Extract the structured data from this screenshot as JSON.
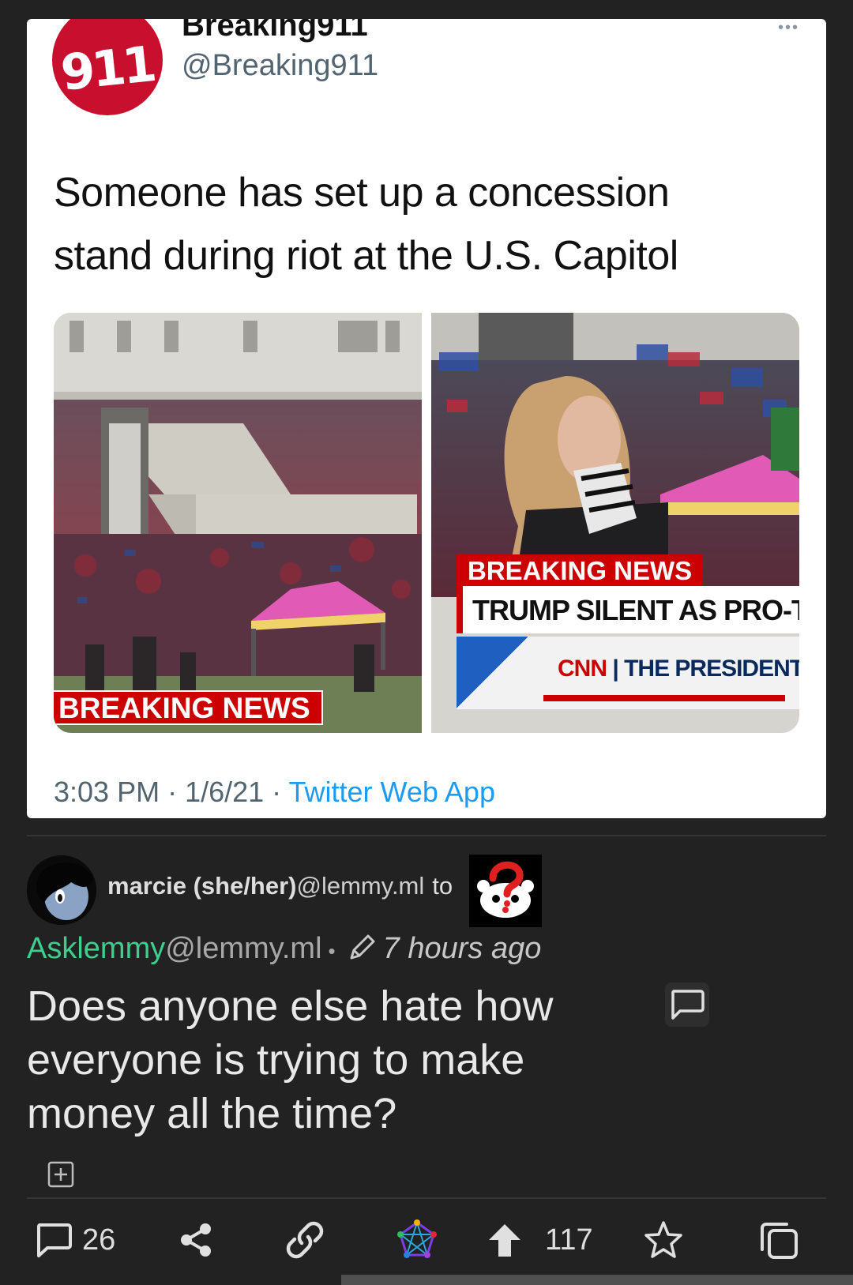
{
  "tweet": {
    "avatar_text": "911",
    "display_name": "Breaking911",
    "handle": "@Breaking911",
    "more_label": "•••",
    "text": "Someone has set up a concession stand during riot at the U.S. Capitol",
    "left_banner": "BREAKING NEWS",
    "right_banner": "BREAKING NEWS",
    "right_headline": "TRUMP SILENT AS PRO-T",
    "right_ticker_brand": "CNN",
    "right_ticker_text": "| THE PRESIDENTIAL ELE",
    "time": "3:03 PM",
    "date": "1/6/21",
    "separator": " · ",
    "app": "Twitter Web App"
  },
  "post": {
    "author_name": "marcie (she/her)",
    "author_instance": "@lemmy.ml",
    "to_label": "to",
    "community_name": "Asklemmy",
    "community_instance": "@lemmy.ml",
    "bullet": "•",
    "time_ago": "7 hours ago",
    "title": "Does anyone else hate how everyone is trying to make money all the time?"
  },
  "actions": {
    "comment_count": "26",
    "upvote_count": "117"
  },
  "colors": {
    "background": "#222222",
    "community_green": "#3ecf8e",
    "twitter_blue": "#1d9bf0",
    "news_red": "#cc0000"
  },
  "icons": [
    "comment-icon",
    "share-icon",
    "link-icon",
    "fediverse-icon",
    "upvote-icon",
    "star-icon",
    "copy-icon",
    "pencil-icon",
    "expand-icon"
  ]
}
